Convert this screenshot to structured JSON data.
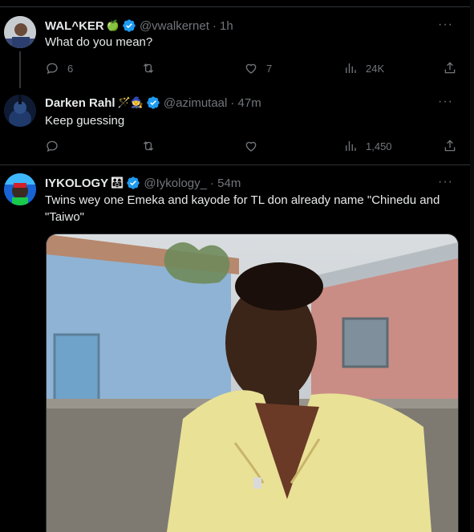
{
  "tweets": [
    {
      "name": "WAL^KER",
      "name_emoji": "🍏",
      "handle": "@vwalkernet",
      "time": "· 1h",
      "text": "What do you mean?",
      "replies": "6",
      "retweets": "",
      "likes": "7",
      "views": "24K"
    },
    {
      "name": "Darken Rahl",
      "name_emoji": "🪄🧙",
      "handle": "@azimutaal",
      "time": "· 47m",
      "text": "Keep guessing",
      "replies": "",
      "retweets": "",
      "likes": "",
      "views": "1,450"
    },
    {
      "name": "IYKOLOGY",
      "name_emoji": "👨‍👩‍👧",
      "handle": "@Iykology_",
      "time": "· 54m",
      "text": "Twins wey one Emeka and kayode for TL don already name  \"Chinedu and \"Taiwo\""
    }
  ],
  "more_label": "···",
  "colors": {
    "background": "#000000",
    "text": "#e7e9ea",
    "muted": "#71767b",
    "verified": "#1d9bf0",
    "divider": "#2f3336"
  },
  "icons": {
    "reply": "reply-icon",
    "retweet": "retweet-icon",
    "like": "like-icon",
    "views": "views-icon",
    "share": "share-icon",
    "verified": "verified-badge-icon",
    "more": "more-icon"
  }
}
